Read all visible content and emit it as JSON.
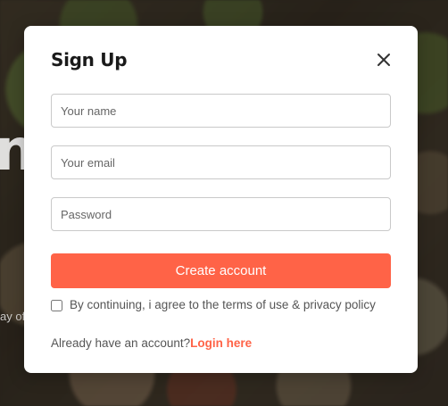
{
  "background": {
    "hero_text_fragment": "n",
    "sub_text_fragment": "ay of"
  },
  "modal": {
    "title": "Sign Up",
    "close_icon": "close-icon",
    "fields": {
      "name_placeholder": "Your name",
      "email_placeholder": "Your email",
      "password_placeholder": "Password"
    },
    "submit_label": "Create account",
    "terms_label": "By continuing, i agree to the terms of use & privacy policy",
    "terms_checked": false,
    "login_prompt": "Already have an account?",
    "login_link_label": "Login here"
  },
  "colors": {
    "accent": "#ff6347",
    "text_dark": "#1a1a1a",
    "text_muted": "#555555"
  }
}
